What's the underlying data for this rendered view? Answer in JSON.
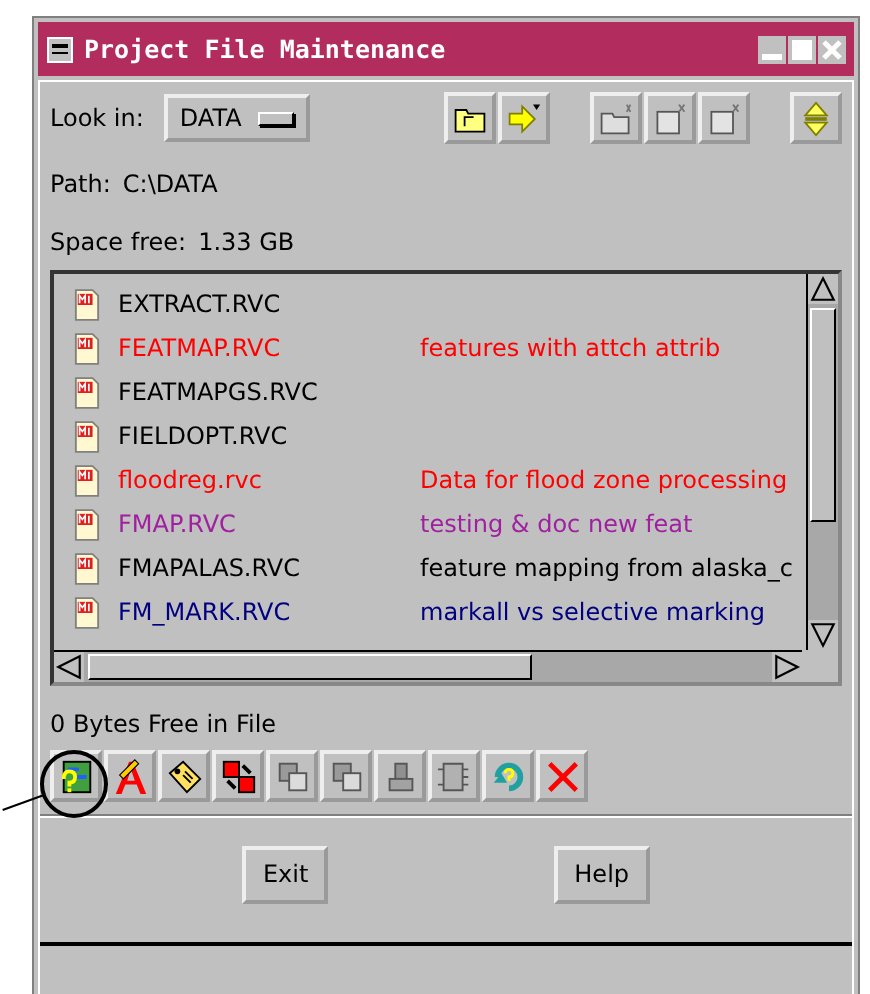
{
  "window": {
    "title": "Project File Maintenance"
  },
  "look_in": {
    "label": "Look in:",
    "value": "DATA"
  },
  "top_tools": [
    {
      "kind": "folder-up",
      "disabled": false
    },
    {
      "kind": "arrow-menu",
      "disabled": false
    },
    {
      "kind": "new-folder",
      "disabled": true
    },
    {
      "kind": "new-file",
      "disabled": true
    },
    {
      "kind": "new-object",
      "disabled": true
    },
    {
      "kind": "toggle",
      "disabled": false
    }
  ],
  "path": {
    "label": "Path:",
    "value": "C:\\DATA"
  },
  "space_free": {
    "label": "Space free:",
    "value": "1.33 GB"
  },
  "files": [
    {
      "name": "EXTRACT.RVC",
      "color": "#000000"
    },
    {
      "name": "FEATMAP.RVC",
      "description": "features with attch attrib",
      "color": "#ff0000"
    },
    {
      "name": "FEATMAPGS.RVC",
      "color": "#000000"
    },
    {
      "name": "FIELDOPT.RVC",
      "color": "#000000"
    },
    {
      "name": "floodreg.rvc",
      "description": "Data for flood zone processing",
      "color": "#ff0000"
    },
    {
      "name": "FMAP.RVC",
      "description": "testing & doc new feat",
      "color": "#a020a0"
    },
    {
      "name": "FMAPALAS.RVC",
      "description": "feature mapping from alaska_c",
      "color": "#000000"
    },
    {
      "name": "FM_MARK.RVC",
      "description": "markall vs selective marking",
      "color": "#000080"
    }
  ],
  "bytes_free": "0 Bytes Free in File",
  "tools": [
    {
      "kind": "info",
      "disabled": false
    },
    {
      "kind": "edit-text",
      "disabled": false
    },
    {
      "kind": "tag",
      "disabled": false
    },
    {
      "kind": "link",
      "disabled": false
    },
    {
      "kind": "copy",
      "disabled": true
    },
    {
      "kind": "merge",
      "disabled": true
    },
    {
      "kind": "stamp",
      "disabled": true
    },
    {
      "kind": "convert",
      "disabled": true
    },
    {
      "kind": "refresh",
      "disabled": false
    },
    {
      "kind": "delete",
      "disabled": false
    }
  ],
  "buttons": [
    "Exit",
    "Help"
  ]
}
